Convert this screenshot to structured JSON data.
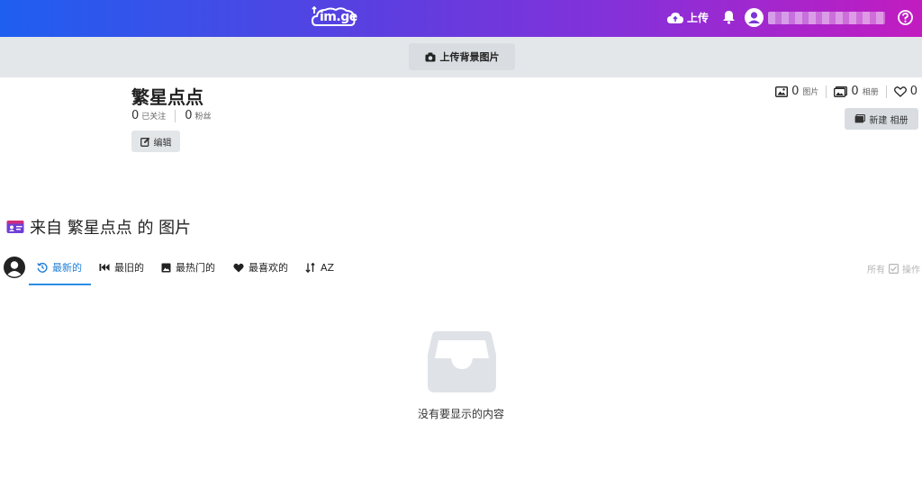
{
  "header": {
    "logo_text": "im.ge",
    "upload_label": "上传",
    "username": "",
    "colors": {
      "gradient_start": "#1e5ff0",
      "gradient_end": "#c21cc0"
    }
  },
  "cover": {
    "upload_cover_label": "上传背景图片"
  },
  "profile": {
    "name": "繁星点点",
    "following_count": "0",
    "following_label": "已关注",
    "followers_count": "0",
    "followers_label": "粉丝",
    "edit_label": "编辑",
    "images_count": "0",
    "images_label": "图片",
    "albums_count": "0",
    "albums_label": "相册",
    "likes_count": "0",
    "new_album_label": "新建 相册"
  },
  "section": {
    "title": "来自 繁星点点 的 图片"
  },
  "tabs": [
    {
      "label": "最新的",
      "icon": "history-icon",
      "active": true
    },
    {
      "label": "最旧的",
      "icon": "backward-icon",
      "active": false
    },
    {
      "label": "最热门的",
      "icon": "image-icon",
      "active": false
    },
    {
      "label": "最喜欢的",
      "icon": "heart-icon",
      "active": false
    },
    {
      "label": "AZ",
      "icon": "sort-icon",
      "active": false
    }
  ],
  "tools": {
    "all_label": "所有",
    "actions_label": "操作"
  },
  "empty": {
    "message": "没有要显示的内容"
  },
  "colors": {
    "accent": "#2b8ee6",
    "button_bg": "#e3e6e9",
    "cover_bg": "#e4e7ea"
  }
}
